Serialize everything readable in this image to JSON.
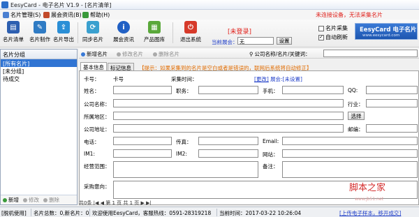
{
  "window": {
    "title": "EesyCard - 电子名片 V1.9 - [名片清单]"
  },
  "menu": [
    {
      "label": "名片管理(S)",
      "color": "#4a7fd1"
    },
    {
      "label": "展会资讯(B)",
      "color": "#c24a2a"
    },
    {
      "label": "帮助(H)",
      "color": "#3a9a3a"
    }
  ],
  "toolbar": {
    "buttons": [
      {
        "label": "名片清单",
        "color": "#2d5fb0"
      },
      {
        "label": "名片制作",
        "color": "#2f7bc4"
      },
      {
        "label": "名片导出",
        "color": "#2b8fd6"
      },
      {
        "label": "同步名片",
        "color": "#3aa0cf"
      },
      {
        "label": "展会资讯",
        "color": "#2160c4"
      },
      {
        "label": "产品图库",
        "color": "#5aa83a"
      },
      {
        "label": "退出系统",
        "color": "#d63a2a"
      }
    ],
    "login_status": "[未登录]",
    "current_expo_label": "当前展会：",
    "current_expo_value": "无",
    "settings_button": "设置"
  },
  "top_right": {
    "warning": "未连接设备，无法采集名片",
    "collect_checkbox": {
      "label": "名片采集",
      "checked": false
    },
    "autorefresh_checkbox": {
      "label": "自动刷新",
      "checked": true
    },
    "logo_title": "EesyCard 电子名片",
    "logo_url": "www.eesycard.com"
  },
  "left_panel": {
    "header": "名片分组",
    "groups": [
      "[所有名片]",
      "[未分组]",
      "待成交"
    ],
    "selected_index": 0,
    "footer": {
      "add": "新增",
      "edit": "修改",
      "delete": "删除"
    }
  },
  "card_toolbar": {
    "new": "新增名片",
    "edit": "修改名片",
    "delete": "删除名片",
    "search_label": "公司名称/名片/关键词："
  },
  "tabs": [
    {
      "label": "基本信息",
      "active": true
    },
    {
      "label": "标记信息",
      "active": false
    }
  ],
  "tip": "【提示：如果采集到的名片是空白或者是错误的，联网后系统将自动修正】",
  "form": {
    "card_no_label": "卡号：",
    "card_no_value": "卡号",
    "collect_time_label": "采集时间：",
    "change_link": "[更改]",
    "expo_label": "展会:[未设置]",
    "name_label": "姓名：",
    "title_label": "职务：",
    "mobile_label": "手机：",
    "qq_label": "QQ:",
    "company_label": "公司名称：",
    "industry_label": "行业：",
    "region_label": "所属地区：",
    "select_button": "选择",
    "address_label": "公司地址：",
    "postcode_label": "邮编：",
    "phone_label": "电话：",
    "fax_label": "传真：",
    "email_label": "Email:",
    "im1_label": "IM1:",
    "im2_label": "IM2:",
    "website_label": "网站：",
    "business_label": "经营范围：",
    "note_label": "备注：",
    "purchase_label": "采购意向："
  },
  "pager": "共0条  |◀  ◀  第  1  页  共  1  页  ▶  ▶|",
  "status_bar": {
    "mode": "[脱机使用]",
    "total": "名片总数：0,新名片：0",
    "welcome": "欢迎使用EesyCard，客服热线：0591-28319218",
    "time": "当前时间：2017-03-22 10:26:04",
    "right_link": "[上传电子样本，移开成交]"
  },
  "watermark": {
    "text": "脚本之家",
    "sub": "www.jb51.net"
  }
}
